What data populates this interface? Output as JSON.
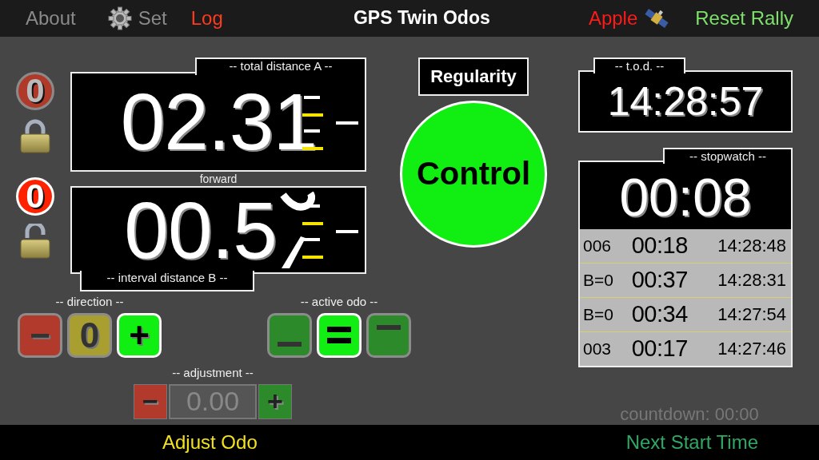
{
  "menu_bar": {
    "left_items": [
      {
        "label": "About",
        "kind": "plain",
        "color": "#8a8a8a"
      },
      {
        "label": "Set",
        "kind": "settings",
        "color": "#8a8a8a"
      },
      {
        "label": "Log",
        "kind": "plain",
        "color": "#ff3b1f"
      }
    ],
    "title": "GPS Twin Odos",
    "right_items": [
      {
        "label": "Apple",
        "kind": "satellite",
        "color": "#ff1a1a"
      },
      {
        "label": "Reset Rally",
        "kind": "plain",
        "color": "#7ee06a"
      }
    ]
  },
  "odometers": [
    {
      "label": "-- total distance A --",
      "kind": "top_tab",
      "value": "02.31",
      "rolling": false,
      "badge": "0",
      "badge_active": false,
      "locked": true
    },
    {
      "label": "-- interval distance B --",
      "kind": "bottom_tab",
      "value": "00.5",
      "rolling": true,
      "badge": "0",
      "badge_active": true,
      "locked": false
    }
  ],
  "direction_caption": "forward",
  "direction": {
    "label": "-- direction --",
    "buttons": [
      {
        "label": "−",
        "color": "#b13a2c",
        "selected": false
      },
      {
        "label": "0",
        "color": "#a99f30",
        "selected": false
      },
      {
        "label": "+",
        "color": "#11ee11",
        "selected": true
      }
    ]
  },
  "active_odo": {
    "label": "-- active odo --",
    "buttons": [
      {
        "kind": "low",
        "selected": false
      },
      {
        "kind": "both",
        "selected": true
      },
      {
        "kind": "high",
        "selected": false
      }
    ]
  },
  "adjustment": {
    "label": "-- adjustment --",
    "minus": "−",
    "placeholder": "0.00",
    "plus": "+"
  },
  "regularity": "Regularity",
  "control": "Control",
  "tod": {
    "label": "-- t.o.d. --",
    "time": "14:28:57"
  },
  "stopwatch": {
    "label": "-- stopwatch --",
    "time": "00:08",
    "laps": [
      {
        "tag": "006",
        "split": "00:18",
        "time": "14:28:48"
      },
      {
        "tag": "B=0",
        "split": "00:37",
        "time": "14:28:31"
      },
      {
        "tag": "B=0",
        "split": "00:34",
        "time": "14:27:54"
      },
      {
        "tag": "003",
        "split": "00:17",
        "time": "14:27:46"
      }
    ]
  },
  "countdown": "countdown: 00:00",
  "bottom_bar": [
    {
      "label": "Adjust Odo",
      "color": "#f2e21c"
    },
    {
      "label": "Next Start Time",
      "color": "#2fa866"
    }
  ]
}
